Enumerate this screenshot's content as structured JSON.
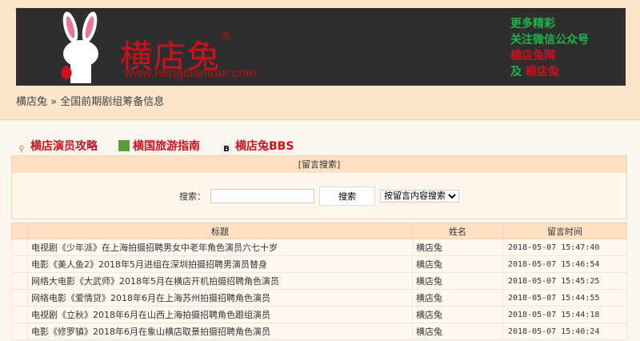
{
  "banner": {
    "brand": "横店兔",
    "reg": "®",
    "url": "www.hengdiantour.com",
    "promo": [
      "更多精彩",
      "关注微信公众号",
      "横店兔网",
      "及",
      "横店兔"
    ]
  },
  "breadcrumb": {
    "home": "横店兔",
    "sep": "»",
    "current": "全国前期剧组筹备信息"
  },
  "links": [
    {
      "label": "横店演员攻略",
      "icon": "key-icon"
    },
    {
      "label": "横国旅游指南",
      "icon": "map-icon"
    },
    {
      "label": "横店兔BBS",
      "icon": "bbs-icon"
    }
  ],
  "search": {
    "title": "[留言搜索]",
    "label": "搜索：",
    "value": "",
    "button": "搜索",
    "mode": "按留言内容搜索"
  },
  "table": {
    "headers": [
      "标题",
      "姓名",
      "留言时间"
    ],
    "rows": [
      [
        "电视剧《少年派》在上海拍摄招聘男女中老年角色演员六七十岁",
        "横店兔",
        "2018-05-07 15:47:40"
      ],
      [
        "电影《美人鱼2》2018年5月进组在深圳拍摄招聘男演员替身",
        "横店兔",
        "2018-05-07 15:46:54"
      ],
      [
        "网络大电影《大武师》2018年5月在横店开机拍摄招聘角色演员",
        "横店兔",
        "2018-05-07 15:45:25"
      ],
      [
        "网络电影《爱情贷》2018年6月在上海苏州拍摄招聘角色演员",
        "横店兔",
        "2018-05-07 15:44:55"
      ],
      [
        "电视剧《立秋》2018年6月在山西上海拍摄招聘角色跟组演员",
        "横店兔",
        "2018-05-07 15:44:18"
      ],
      [
        "电影《修罗镇》2018年6月在象山横店取景拍摄招聘角色演员",
        "横店兔",
        "2018-05-07 15:40:24"
      ]
    ]
  }
}
